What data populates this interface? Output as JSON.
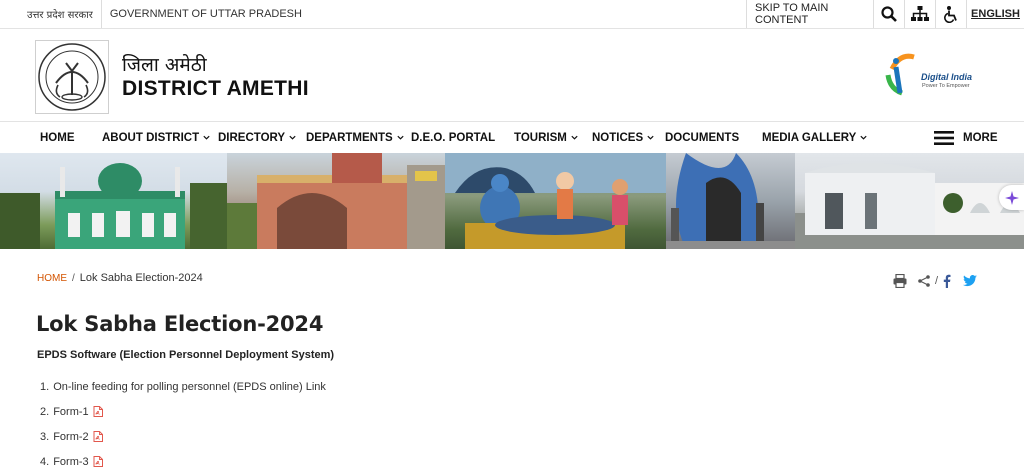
{
  "topbar": {
    "gov_hindi": "उत्तर प्रदेश सरकार",
    "gov_english": "GOVERNMENT OF UTTAR PRADESH",
    "skip": "SKIP TO MAIN CONTENT",
    "icons": [
      "search-icon",
      "sitemap-icon",
      "accessibility-icon"
    ],
    "language": "ENGLISH"
  },
  "header": {
    "title_hindi": "जिला अमेठी",
    "title_english": "DISTRICT AMETHI",
    "logo_right_text": "Digital India",
    "logo_right_tagline": "Power To Empower"
  },
  "nav": {
    "items": [
      {
        "label": "HOME",
        "dropdown": false
      },
      {
        "label": "ABOUT DISTRICT",
        "dropdown": true
      },
      {
        "label": "DIRECTORY",
        "dropdown": true
      },
      {
        "label": "DEPARTMENTS",
        "dropdown": true
      },
      {
        "label": "D.E.O. PORTAL",
        "dropdown": false
      },
      {
        "label": "TOURISM",
        "dropdown": true
      },
      {
        "label": "NOTICES",
        "dropdown": true
      },
      {
        "label": "DOCUMENTS",
        "dropdown": false
      },
      {
        "label": "MEDIA GALLERY",
        "dropdown": true
      }
    ],
    "more": "MORE"
  },
  "breadcrumb": {
    "home": "HOME",
    "separator": "/",
    "current": "Lok Sabha Election-2024"
  },
  "share": {
    "icons": [
      "print-icon",
      "share-icon",
      "facebook-icon",
      "twitter-icon"
    ],
    "separator": "/"
  },
  "main": {
    "title": "Lok Sabha Election-2024",
    "subheading": "EPDS Software (Election Personnel Deployment System)",
    "items": [
      {
        "num": "1.",
        "text": "On-line feeding for polling personnel (EPDS online) Link",
        "pdf": false
      },
      {
        "num": "2.",
        "text": "Form-1",
        "pdf": true
      },
      {
        "num": "3.",
        "text": "Form-2",
        "pdf": true
      },
      {
        "num": "4.",
        "text": "Form-3",
        "pdf": true
      }
    ]
  },
  "colors": {
    "breadcrumb_home": "#d35400",
    "pdf_icon": "#e2574c",
    "facebook": "#3b5998",
    "twitter": "#1da1f2"
  }
}
